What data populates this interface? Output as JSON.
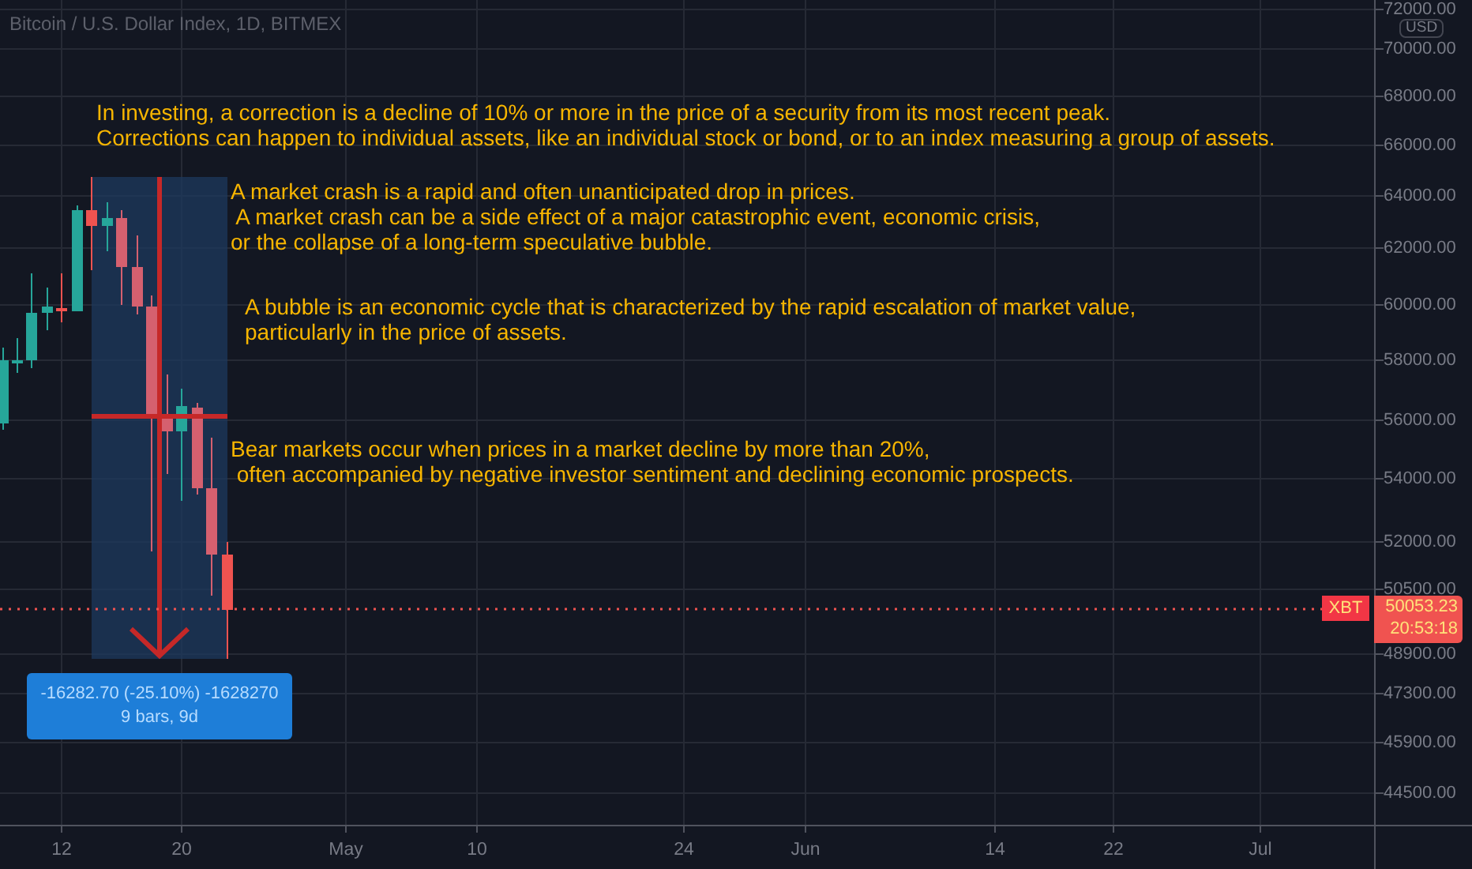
{
  "chart_title": "Bitcoin / U.S. Dollar Index, 1D, BITMEX",
  "annotations": [
    {
      "text": "In investing, a correction is a decline of 10% or more in the price of a security from its most recent peak.\nCorrections can happen to individual assets, like an individual stock or bond, or to an index measuring a group of assets."
    },
    {
      "text": "A market crash is a rapid and often unanticipated drop in prices.\n A market crash can be a side effect of a major catastrophic event, economic crisis,\nor the collapse of a long-term speculative bubble."
    },
    {
      "text": "A bubble is an economic cycle that is characterized by the rapid escalation of market value,\nparticularly in the price of assets."
    },
    {
      "text": "Bear markets occur when prices in a market decline by more than 20%,\n often accompanied by negative investor sentiment and declining economic prospects."
    }
  ],
  "measure": {
    "change": "-16282.70 (-25.10%) -1628270",
    "span": "9 bars, 9d"
  },
  "price_axis": {
    "currency": "USD",
    "labels": [
      "72000.00",
      "70000.00",
      "68000.00",
      "66000.00",
      "64000.00",
      "62000.00",
      "60000.00",
      "58000.00",
      "56000.00",
      "54000.00",
      "52000.00",
      "50500.00",
      "48900.00",
      "47300.00",
      "45900.00",
      "44500.00"
    ]
  },
  "last_price": {
    "symbol": "XBT",
    "price": "50053.23",
    "countdown": "20:53:18"
  },
  "time_axis": {
    "labels": [
      "12",
      "20",
      "May",
      "10",
      "24",
      "Jun",
      "14",
      "22",
      "Jul"
    ]
  }
}
